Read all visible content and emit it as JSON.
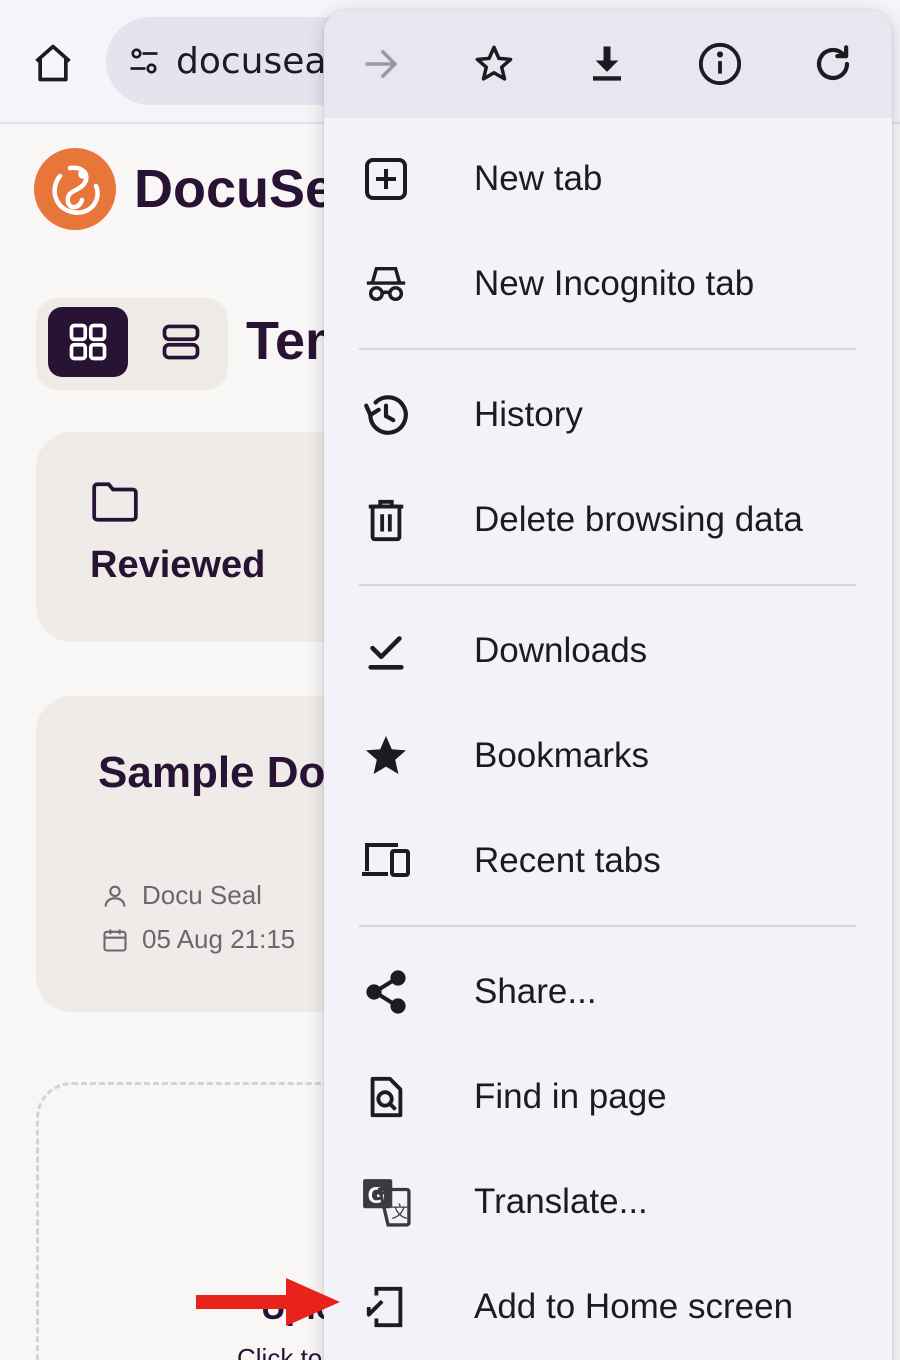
{
  "browser": {
    "url_text": "docuseal"
  },
  "page": {
    "brand": "DocuSeal",
    "section_title": "Templates",
    "folder": {
      "name": "Reviewed"
    },
    "document": {
      "title": "Sample Document",
      "author": "Docu Seal",
      "date": "05 Aug 21:15"
    },
    "upload": {
      "title": "Upload",
      "subtitle": "Click to"
    }
  },
  "menu": {
    "toolbar": [
      {
        "icon": "forward-arrow-icon"
      },
      {
        "icon": "bookmark-star-icon"
      },
      {
        "icon": "download-icon"
      },
      {
        "icon": "info-icon"
      },
      {
        "icon": "refresh-icon"
      }
    ],
    "items": [
      {
        "label": "New tab",
        "icon": "new-tab-icon"
      },
      {
        "label": "New Incognito tab",
        "icon": "incognito-icon"
      },
      {
        "label": "History",
        "icon": "history-icon"
      },
      {
        "label": "Delete browsing data",
        "icon": "trash-icon"
      },
      {
        "label": "Downloads",
        "icon": "downloads-check-icon"
      },
      {
        "label": "Bookmarks",
        "icon": "star-filled-icon"
      },
      {
        "label": "Recent tabs",
        "icon": "devices-icon"
      },
      {
        "label": "Share...",
        "icon": "share-icon"
      },
      {
        "label": "Find in page",
        "icon": "find-in-page-icon"
      },
      {
        "label": "Translate...",
        "icon": "translate-icon"
      },
      {
        "label": "Add to Home screen",
        "icon": "add-to-home-icon"
      }
    ]
  },
  "colors": {
    "brand_orange": "#e8753a",
    "brand_dark": "#291334",
    "annotation_arrow": "#e8231c"
  }
}
